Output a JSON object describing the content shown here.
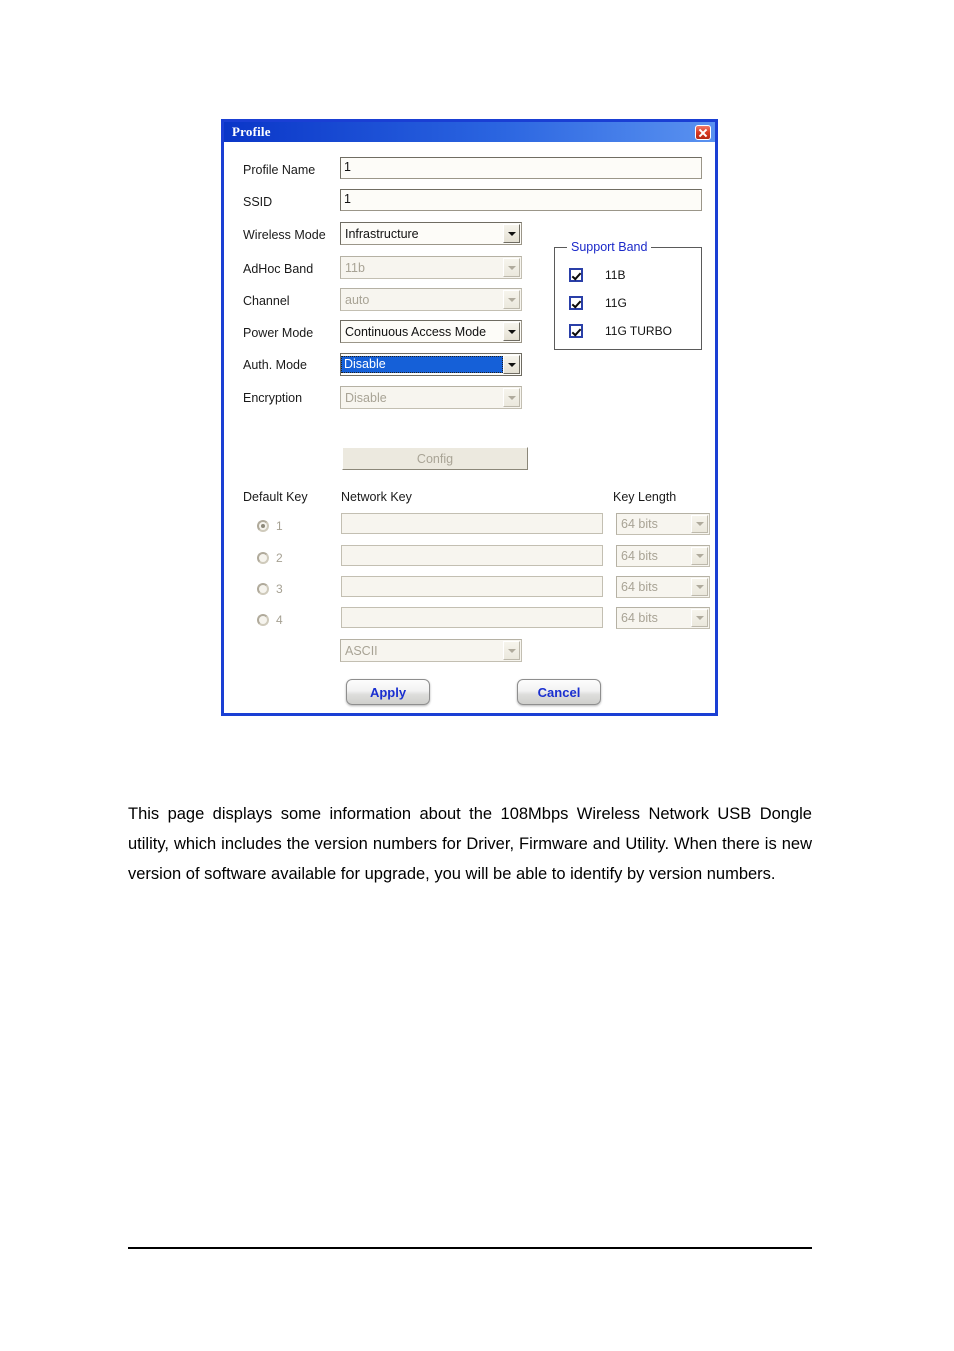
{
  "dialog": {
    "title": "Profile",
    "close_icon": "close-icon",
    "fields": {
      "profile_name": {
        "label": "Profile Name",
        "value": "1"
      },
      "ssid": {
        "label": "SSID",
        "value": "1"
      },
      "wireless_mode": {
        "label": "Wireless Mode",
        "value": "Infrastructure",
        "enabled": true
      },
      "adhoc_band": {
        "label": "AdHoc Band",
        "value": "11b",
        "enabled": false
      },
      "channel": {
        "label": "Channel",
        "value": "auto",
        "enabled": false
      },
      "power_mode": {
        "label": "Power Mode",
        "value": "Continuous Access Mode",
        "enabled": true
      },
      "auth_mode": {
        "label": "Auth. Mode",
        "value": "Disable",
        "enabled": true,
        "focused": true
      },
      "encryption": {
        "label": "Encryption",
        "value": "Disable",
        "enabled": false
      }
    },
    "support_band": {
      "legend": "Support Band",
      "items": [
        {
          "label": "11B",
          "checked": true
        },
        {
          "label": "11G",
          "checked": true
        },
        {
          "label": "11G TURBO",
          "checked": true
        }
      ]
    },
    "config_button": {
      "label": "Config",
      "enabled": false
    },
    "key_section": {
      "headers": {
        "default_key": "Default Key",
        "network_key": "Network Key",
        "key_length": "Key Length"
      },
      "rows": [
        {
          "index": "1",
          "selected": true,
          "key_value": "",
          "key_length": "64 bits"
        },
        {
          "index": "2",
          "selected": false,
          "key_value": "",
          "key_length": "64 bits"
        },
        {
          "index": "3",
          "selected": false,
          "key_value": "",
          "key_length": "64 bits"
        },
        {
          "index": "4",
          "selected": false,
          "key_value": "",
          "key_length": "64 bits"
        }
      ],
      "format": {
        "value": "ASCII",
        "enabled": false
      }
    },
    "buttons": {
      "apply": "Apply",
      "cancel": "Cancel"
    }
  },
  "page": {
    "paragraph": "This page displays some information about the 108Mbps Wireless Network USB Dongle utility, which includes the version numbers for Driver, Firmware and Utility.   When there is new version of software available for upgrade, you will be able to identify by version numbers."
  },
  "colors": {
    "titlebar_blue": "#0a36c8",
    "dialog_border": "#1a3fd4",
    "legend_blue": "#1b29c9",
    "button_text_blue": "#1a2fd0",
    "selection_blue": "#1560d8",
    "close_red": "#d93a21",
    "disabled_text": "#a8a395"
  }
}
